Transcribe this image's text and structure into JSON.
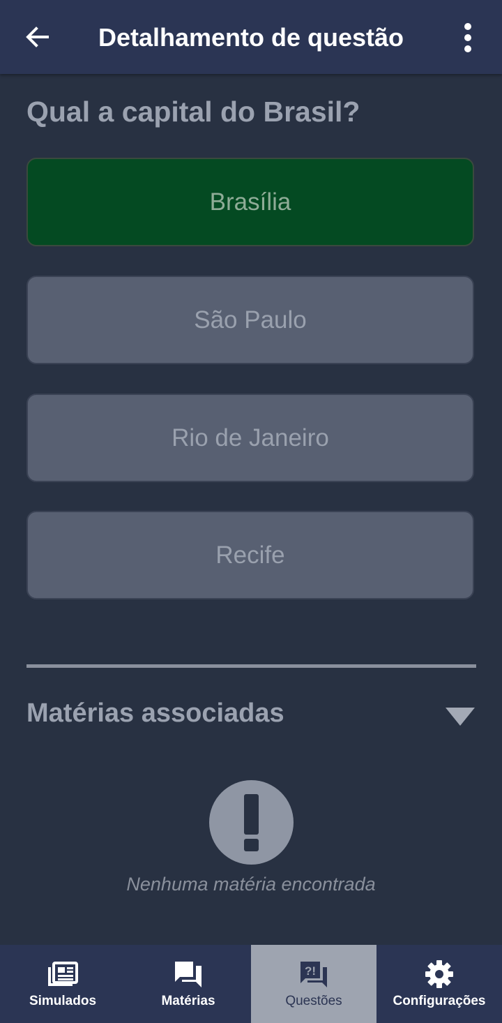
{
  "appbar": {
    "title": "Detalhamento de questão",
    "back_icon": "arrow-left-icon",
    "menu_icon": "more-vert-icon"
  },
  "question": {
    "text": "Qual a capital do Brasil?"
  },
  "options": [
    {
      "label": "Brasília",
      "status": "correct"
    },
    {
      "label": "São Paulo",
      "status": "neutral"
    },
    {
      "label": "Rio de Janeiro",
      "status": "neutral"
    },
    {
      "label": "Recife",
      "status": "neutral"
    }
  ],
  "subjects_section": {
    "title": "Matérias associadas",
    "expanded": true,
    "empty_icon": "exclamation-circle-icon",
    "empty_text": "Nenhuma matéria encontrada"
  },
  "bottom_nav": {
    "items": [
      {
        "label": "Simulados",
        "icon": "newspaper-icon",
        "active": false
      },
      {
        "label": "Matérias",
        "icon": "forum-icon",
        "active": false
      },
      {
        "label": "Questões",
        "icon": "question-chat-icon",
        "active": true
      },
      {
        "label": "Configurações",
        "icon": "gear-icon",
        "active": false
      }
    ]
  },
  "colors": {
    "background": "#283142",
    "appbar": "#2b3554",
    "correct_option": "#044a22",
    "neutral_option": "#586072",
    "active_nav": "#9ea4b0"
  }
}
